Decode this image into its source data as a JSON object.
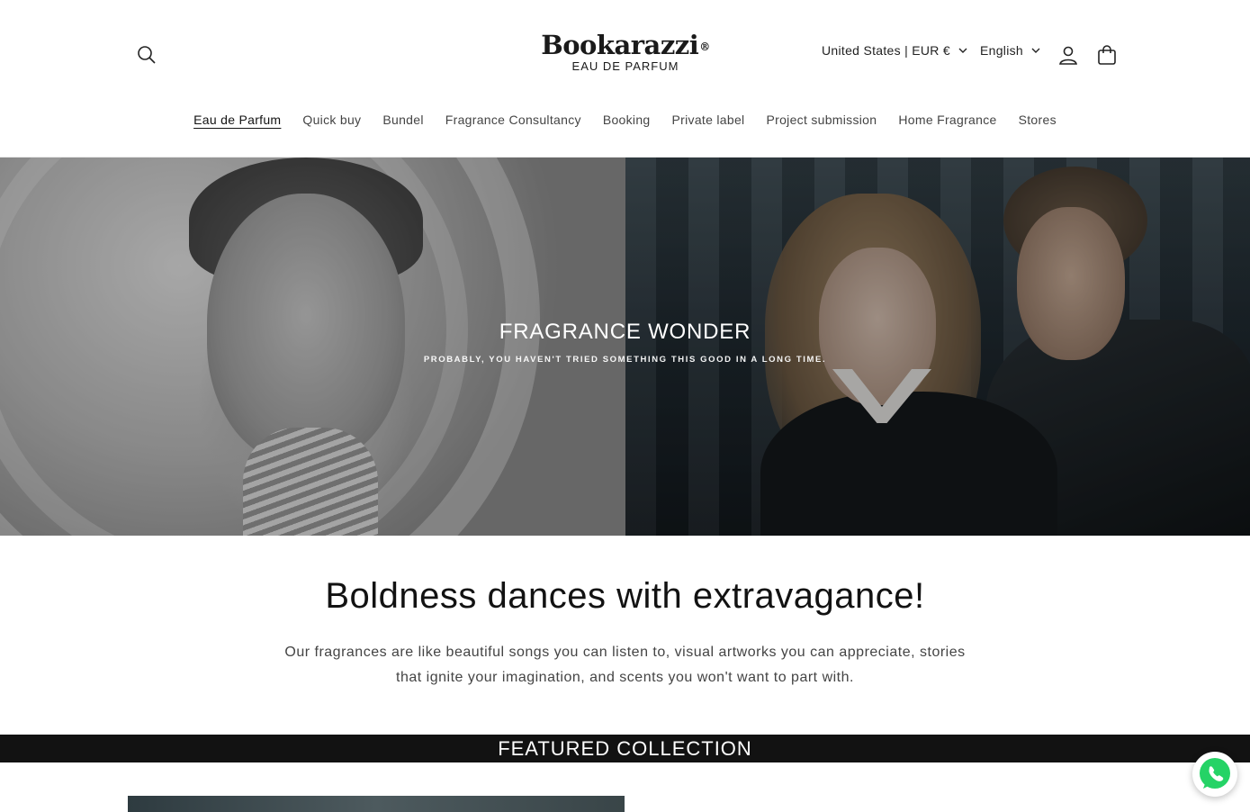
{
  "header": {
    "search_icon": "search-icon",
    "logo": {
      "name": "Bookarazzi",
      "registered": "®",
      "subtitle": "EAU DE PARFUM"
    },
    "country_selector": "United States | EUR €",
    "language_selector": "English",
    "account_icon": "user-icon",
    "cart_icon": "bag-icon"
  },
  "nav": {
    "items": [
      {
        "label": "Eau de Parfum",
        "active": true
      },
      {
        "label": "Quick buy"
      },
      {
        "label": "Bundel"
      },
      {
        "label": "Fragrance Consultancy"
      },
      {
        "label": "Booking"
      },
      {
        "label": "Private label"
      },
      {
        "label": "Project submission"
      },
      {
        "label": "Home Fragrance"
      },
      {
        "label": "Stores"
      }
    ]
  },
  "hero": {
    "title": "FRAGRANCE WONDER",
    "subtitle": "PROBABLY, YOU HAVEN'T TRIED SOMETHING THIS GOOD IN A LONG TIME."
  },
  "rich_text": {
    "heading": "Boldness dances with extravagance!",
    "body": "Our fragrances are like beautiful songs you can listen to, visual artworks you can appreciate, stories that ignite your imagination, and scents you won't want to part with."
  },
  "featured": {
    "title": "FEATURED COLLECTION"
  },
  "whatsapp": {
    "icon": "whatsapp-icon",
    "color": "#25D366"
  },
  "colors": {
    "text": "#121212",
    "band": "#121212",
    "background": "#ffffff"
  }
}
